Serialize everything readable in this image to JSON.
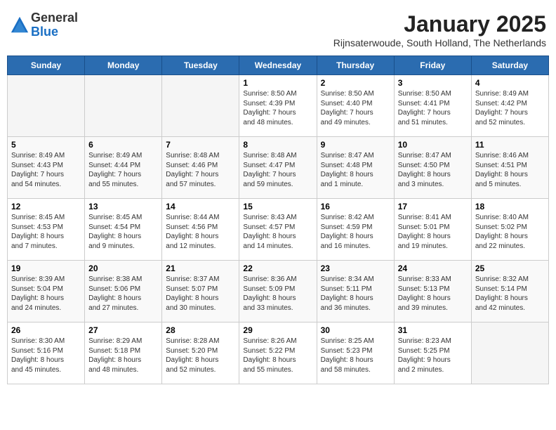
{
  "header": {
    "logo_line1": "General",
    "logo_line2": "Blue",
    "month": "January 2025",
    "location": "Rijnsaterwoude, South Holland, The Netherlands"
  },
  "weekdays": [
    "Sunday",
    "Monday",
    "Tuesday",
    "Wednesday",
    "Thursday",
    "Friday",
    "Saturday"
  ],
  "weeks": [
    [
      {
        "day": "",
        "info": ""
      },
      {
        "day": "",
        "info": ""
      },
      {
        "day": "",
        "info": ""
      },
      {
        "day": "1",
        "info": "Sunrise: 8:50 AM\nSunset: 4:39 PM\nDaylight: 7 hours\nand 48 minutes."
      },
      {
        "day": "2",
        "info": "Sunrise: 8:50 AM\nSunset: 4:40 PM\nDaylight: 7 hours\nand 49 minutes."
      },
      {
        "day": "3",
        "info": "Sunrise: 8:50 AM\nSunset: 4:41 PM\nDaylight: 7 hours\nand 51 minutes."
      },
      {
        "day": "4",
        "info": "Sunrise: 8:49 AM\nSunset: 4:42 PM\nDaylight: 7 hours\nand 52 minutes."
      }
    ],
    [
      {
        "day": "5",
        "info": "Sunrise: 8:49 AM\nSunset: 4:43 PM\nDaylight: 7 hours\nand 54 minutes."
      },
      {
        "day": "6",
        "info": "Sunrise: 8:49 AM\nSunset: 4:44 PM\nDaylight: 7 hours\nand 55 minutes."
      },
      {
        "day": "7",
        "info": "Sunrise: 8:48 AM\nSunset: 4:46 PM\nDaylight: 7 hours\nand 57 minutes."
      },
      {
        "day": "8",
        "info": "Sunrise: 8:48 AM\nSunset: 4:47 PM\nDaylight: 7 hours\nand 59 minutes."
      },
      {
        "day": "9",
        "info": "Sunrise: 8:47 AM\nSunset: 4:48 PM\nDaylight: 8 hours\nand 1 minute."
      },
      {
        "day": "10",
        "info": "Sunrise: 8:47 AM\nSunset: 4:50 PM\nDaylight: 8 hours\nand 3 minutes."
      },
      {
        "day": "11",
        "info": "Sunrise: 8:46 AM\nSunset: 4:51 PM\nDaylight: 8 hours\nand 5 minutes."
      }
    ],
    [
      {
        "day": "12",
        "info": "Sunrise: 8:45 AM\nSunset: 4:53 PM\nDaylight: 8 hours\nand 7 minutes."
      },
      {
        "day": "13",
        "info": "Sunrise: 8:45 AM\nSunset: 4:54 PM\nDaylight: 8 hours\nand 9 minutes."
      },
      {
        "day": "14",
        "info": "Sunrise: 8:44 AM\nSunset: 4:56 PM\nDaylight: 8 hours\nand 12 minutes."
      },
      {
        "day": "15",
        "info": "Sunrise: 8:43 AM\nSunset: 4:57 PM\nDaylight: 8 hours\nand 14 minutes."
      },
      {
        "day": "16",
        "info": "Sunrise: 8:42 AM\nSunset: 4:59 PM\nDaylight: 8 hours\nand 16 minutes."
      },
      {
        "day": "17",
        "info": "Sunrise: 8:41 AM\nSunset: 5:01 PM\nDaylight: 8 hours\nand 19 minutes."
      },
      {
        "day": "18",
        "info": "Sunrise: 8:40 AM\nSunset: 5:02 PM\nDaylight: 8 hours\nand 22 minutes."
      }
    ],
    [
      {
        "day": "19",
        "info": "Sunrise: 8:39 AM\nSunset: 5:04 PM\nDaylight: 8 hours\nand 24 minutes."
      },
      {
        "day": "20",
        "info": "Sunrise: 8:38 AM\nSunset: 5:06 PM\nDaylight: 8 hours\nand 27 minutes."
      },
      {
        "day": "21",
        "info": "Sunrise: 8:37 AM\nSunset: 5:07 PM\nDaylight: 8 hours\nand 30 minutes."
      },
      {
        "day": "22",
        "info": "Sunrise: 8:36 AM\nSunset: 5:09 PM\nDaylight: 8 hours\nand 33 minutes."
      },
      {
        "day": "23",
        "info": "Sunrise: 8:34 AM\nSunset: 5:11 PM\nDaylight: 8 hours\nand 36 minutes."
      },
      {
        "day": "24",
        "info": "Sunrise: 8:33 AM\nSunset: 5:13 PM\nDaylight: 8 hours\nand 39 minutes."
      },
      {
        "day": "25",
        "info": "Sunrise: 8:32 AM\nSunset: 5:14 PM\nDaylight: 8 hours\nand 42 minutes."
      }
    ],
    [
      {
        "day": "26",
        "info": "Sunrise: 8:30 AM\nSunset: 5:16 PM\nDaylight: 8 hours\nand 45 minutes."
      },
      {
        "day": "27",
        "info": "Sunrise: 8:29 AM\nSunset: 5:18 PM\nDaylight: 8 hours\nand 48 minutes."
      },
      {
        "day": "28",
        "info": "Sunrise: 8:28 AM\nSunset: 5:20 PM\nDaylight: 8 hours\nand 52 minutes."
      },
      {
        "day": "29",
        "info": "Sunrise: 8:26 AM\nSunset: 5:22 PM\nDaylight: 8 hours\nand 55 minutes."
      },
      {
        "day": "30",
        "info": "Sunrise: 8:25 AM\nSunset: 5:23 PM\nDaylight: 8 hours\nand 58 minutes."
      },
      {
        "day": "31",
        "info": "Sunrise: 8:23 AM\nSunset: 5:25 PM\nDaylight: 9 hours\nand 2 minutes."
      },
      {
        "day": "",
        "info": ""
      }
    ]
  ]
}
